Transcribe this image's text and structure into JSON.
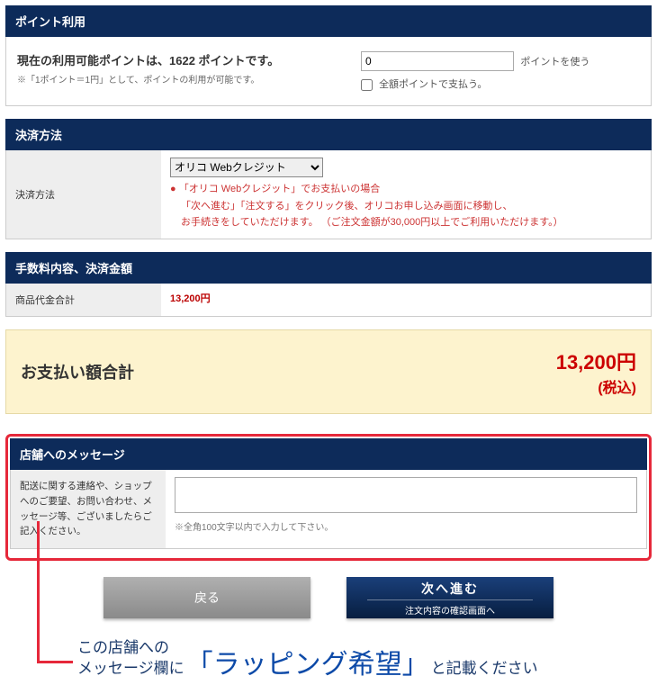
{
  "points": {
    "header": "ポイント利用",
    "available_line": "現在の利用可能ポイントは、1622 ポイントです。",
    "rate_note": "※「1ポイント＝1円」として、ポイントの利用が可能です。",
    "input_value": "0",
    "use_points_label": "ポイントを使う",
    "pay_all_label": "全額ポイントで支払う。"
  },
  "payment": {
    "header": "決済方法",
    "row_label": "決済方法",
    "selected_option": "オリコ Webクレジット",
    "note_line1": "「オリコ Webクレジット」でお支払いの場合",
    "note_line2": "「次へ進む」「注文する」をクリック後、オリコお申し込み画面に移動し、",
    "note_line3": "お手続きをしていただけます。 （ご注文金額が30,000円以上でご利用いただけます。）"
  },
  "fees": {
    "header": "手数料内容、決済金額",
    "row_label": "商品代金合計",
    "amount": "13,200円"
  },
  "total": {
    "label": "お支払い額合計",
    "amount": "13,200円",
    "tax": "(税込)"
  },
  "message": {
    "header": "店舗へのメッセージ",
    "label": "配送に関する連絡や、ショップへのご要望、お問い合わせ、メッセージ等、ございましたらご記入ください。",
    "hint": "※全角100文字以内で入力して下さい。"
  },
  "buttons": {
    "back": "戻る",
    "next_main": "次へ進む",
    "next_sub": "注文内容の確認画面へ"
  },
  "annotation": {
    "lead1": "この店舗への",
    "lead2": "メッセージ欄に",
    "emph": "「ラッピング希望」",
    "tail": "と記載ください"
  }
}
